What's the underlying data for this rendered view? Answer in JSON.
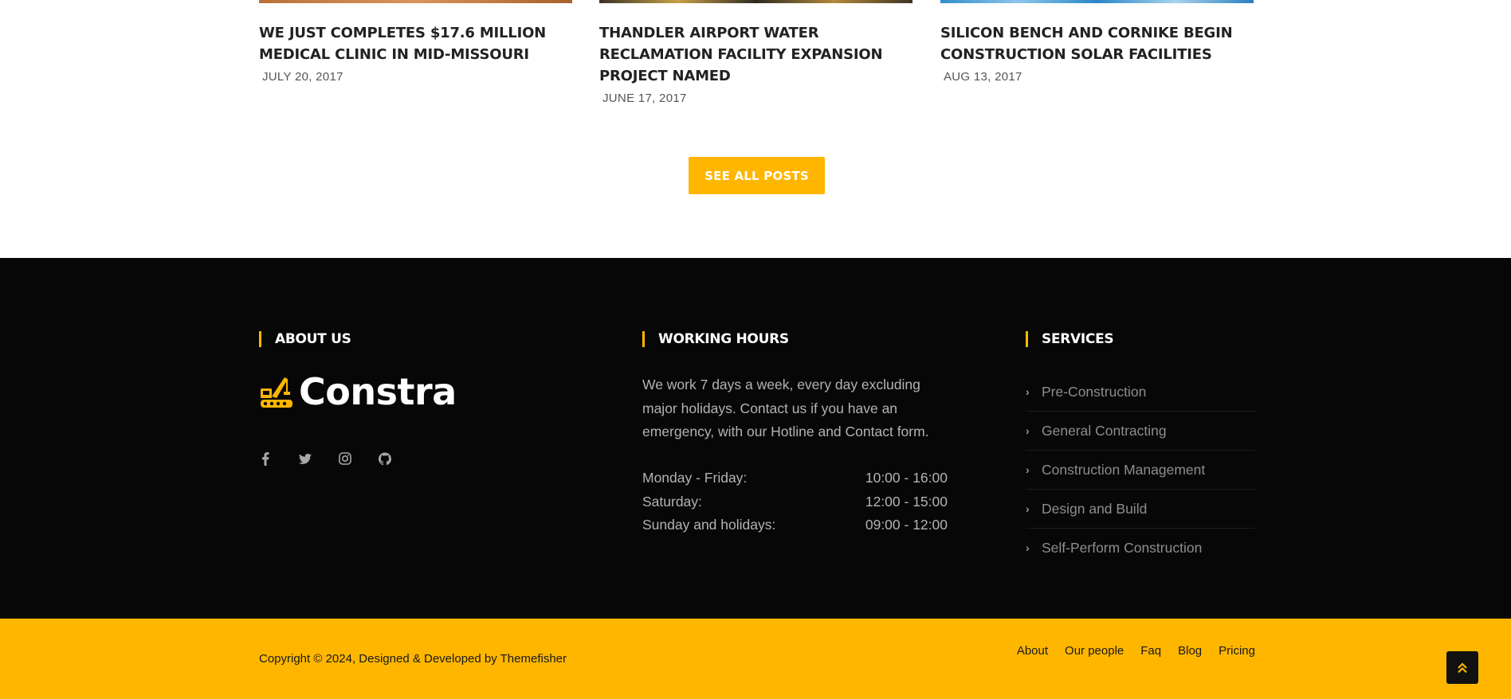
{
  "posts": [
    {
      "title": "WE JUST COMPLETES $17.6 MILLION MEDICAL CLINIC IN MID-MISSOURI",
      "date": "JULY 20, 2017"
    },
    {
      "title": "THANDLER AIRPORT WATER RECLAMATION FACILITY EXPANSION PROJECT NAMED",
      "date": "JUNE 17, 2017"
    },
    {
      "title": "SILICON BENCH AND CORNIKE BEGIN CONSTRUCTION SOLAR FACILITIES",
      "date": "AUG 13, 2017"
    }
  ],
  "see_all_label": "SEE ALL POSTS",
  "about": {
    "title": "ABOUT US",
    "logo_text": "Constra",
    "social_icons": [
      "facebook-icon",
      "twitter-icon",
      "instagram-icon",
      "github-icon"
    ]
  },
  "working": {
    "title": "WORKING HOURS",
    "text": "We work 7 days a week, every day excluding major holidays. Contact us if you have an emergency, with our Hotline and Contact form.",
    "rows": [
      {
        "day": "Monday - Friday:",
        "time": "10:00 - 16:00"
      },
      {
        "day": "Saturday:",
        "time": "12:00 - 15:00"
      },
      {
        "day": "Sunday and holidays:",
        "time": "09:00 - 12:00"
      }
    ]
  },
  "services": {
    "title": "SERVICES",
    "items": [
      "Pre-Construction",
      "General Contracting",
      "Construction Management",
      "Design and Build",
      "Self-Perform Construction"
    ]
  },
  "copyright": {
    "text": "Copyright © 2024, Designed & Developed by Themefisher",
    "links": [
      "About",
      "Our people",
      "Faq",
      "Blog",
      "Pricing"
    ]
  },
  "colors": {
    "accent": "#ffb600",
    "footer_bg": "#070708"
  }
}
